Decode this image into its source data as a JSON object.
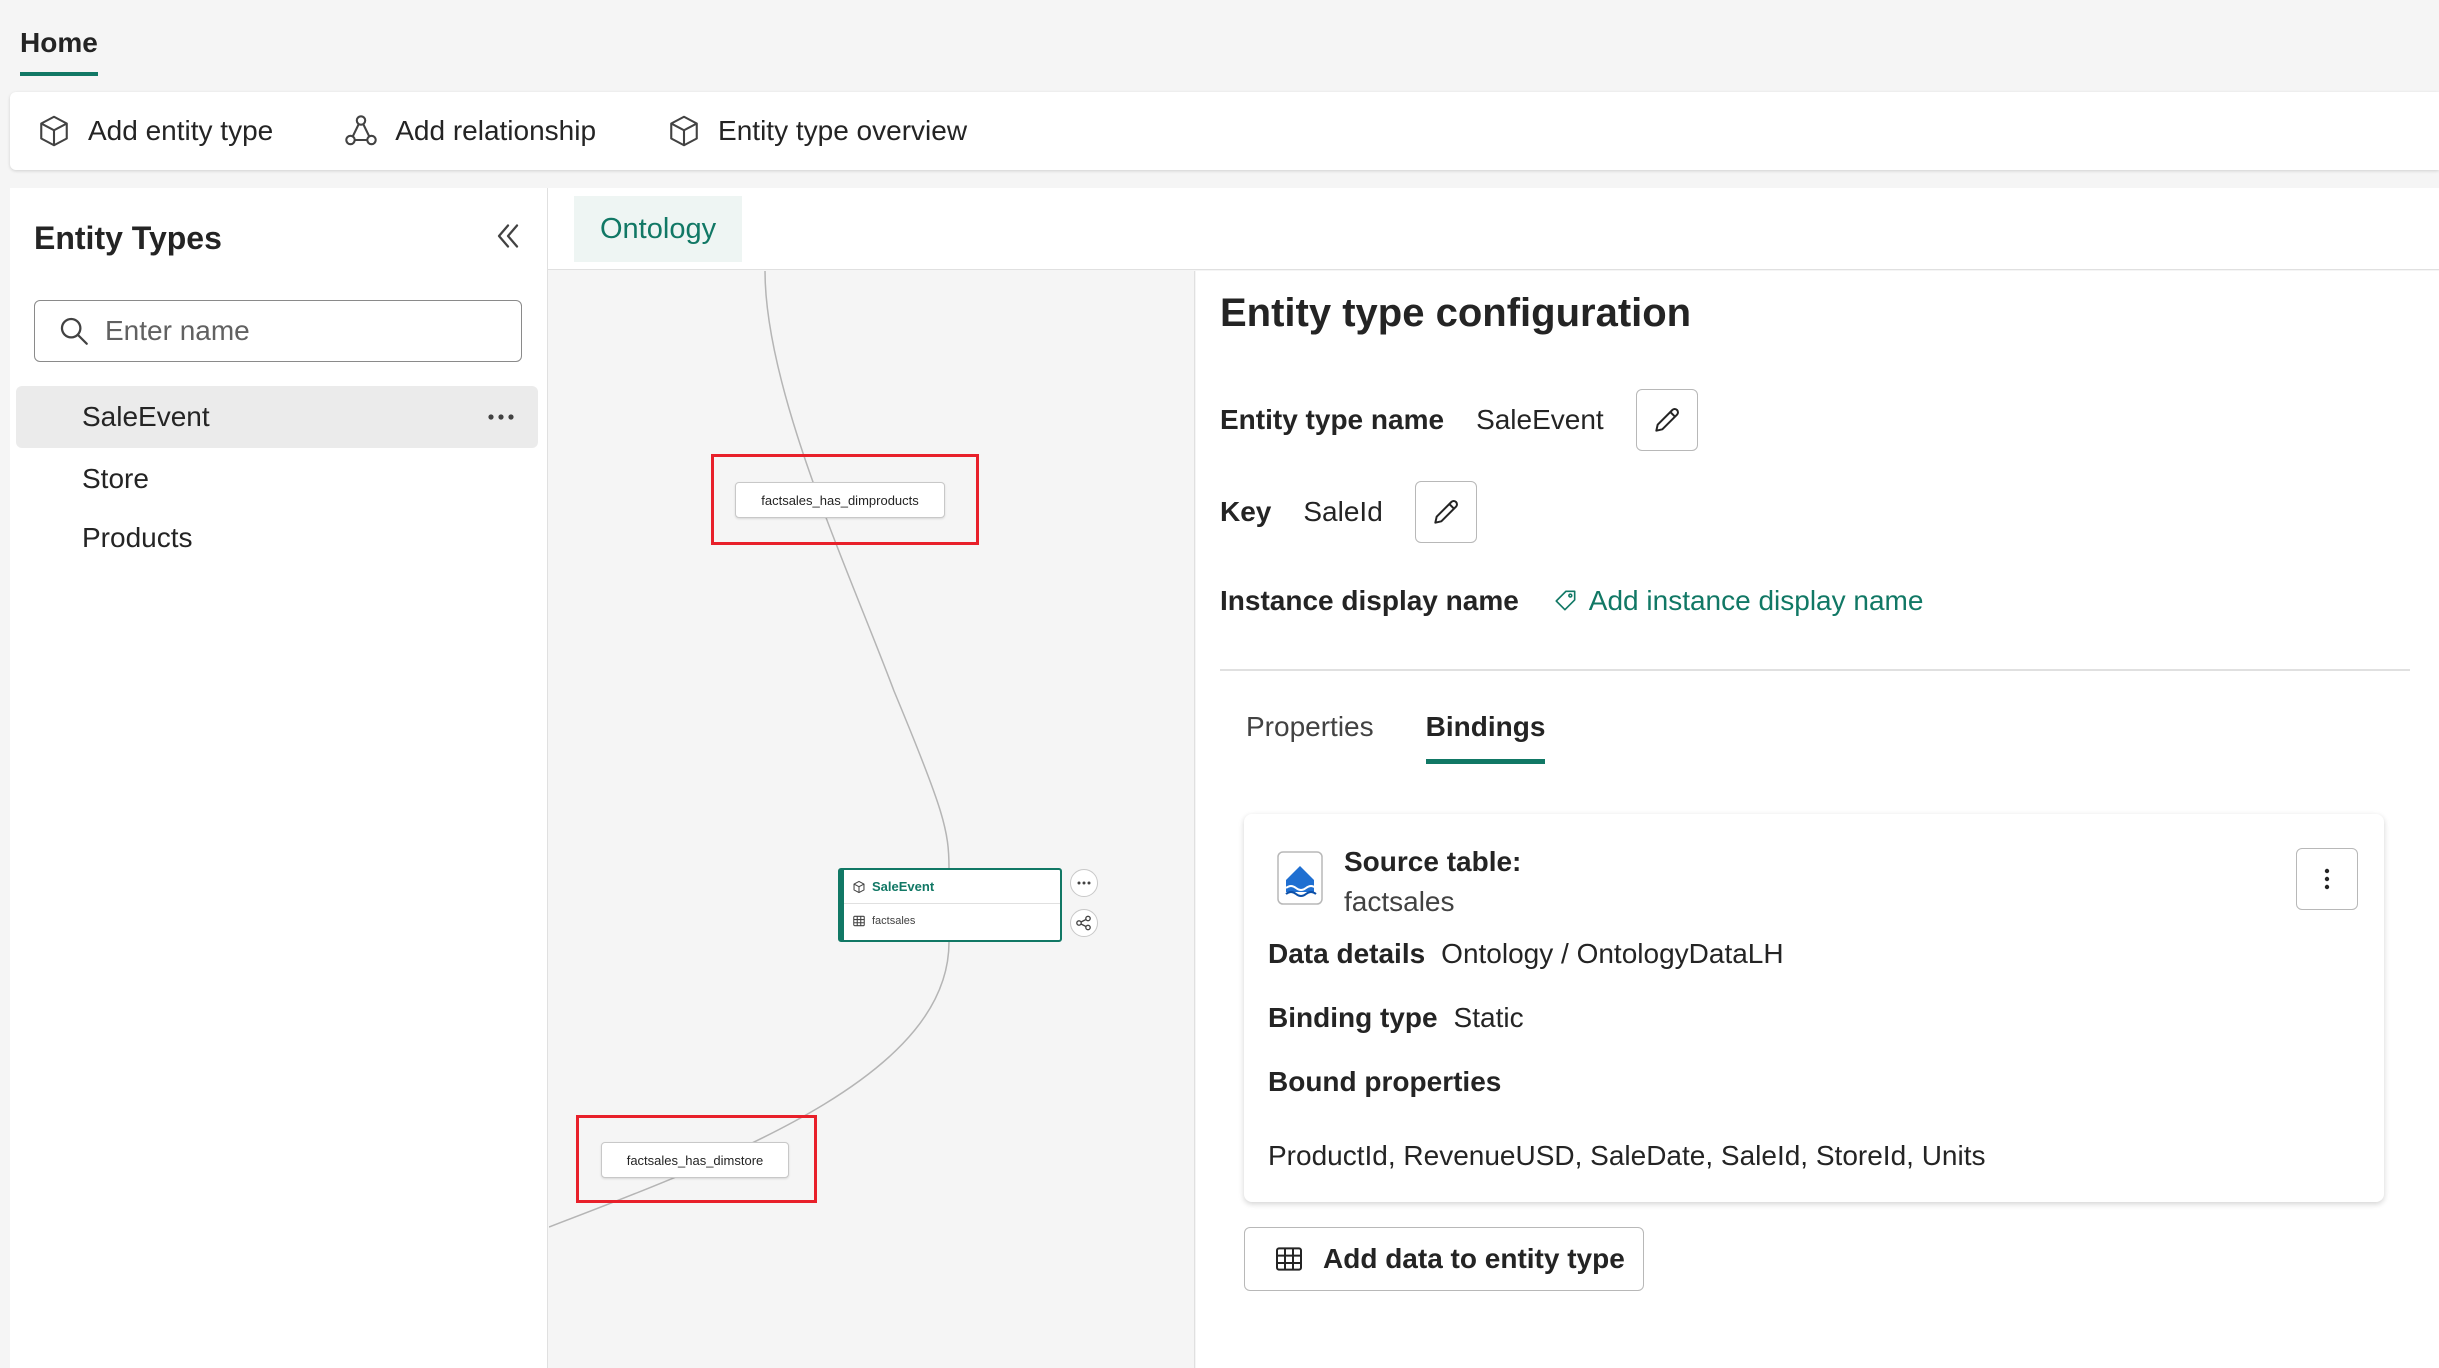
{
  "top_tab": {
    "label": "Home"
  },
  "toolbar": {
    "add_entity_type": "Add entity type",
    "add_relationship": "Add relationship",
    "entity_type_overview": "Entity type overview"
  },
  "left_panel": {
    "title": "Entity Types",
    "search_placeholder": "Enter name",
    "items": [
      {
        "label": "SaleEvent",
        "selected": true
      },
      {
        "label": "Store",
        "selected": false
      },
      {
        "label": "Products",
        "selected": false
      }
    ]
  },
  "canvas": {
    "tab_label": "Ontology",
    "relationships": [
      {
        "label": "factsales_has_dimproducts"
      },
      {
        "label": "factsales_has_dimstore"
      }
    ],
    "node": {
      "title": "SaleEvent",
      "source": "factsales"
    }
  },
  "config": {
    "title": "Entity type configuration",
    "entity_type_name_label": "Entity type name",
    "entity_type_name_value": "SaleEvent",
    "key_label": "Key",
    "key_value": "SaleId",
    "instance_display_label": "Instance display name",
    "add_instance_display": "Add instance display name",
    "tabs": [
      {
        "label": "Properties",
        "active": false
      },
      {
        "label": "Bindings",
        "active": true
      }
    ],
    "binding": {
      "source_table_label": "Source table:",
      "source_table_value": "factsales",
      "data_details_label": "Data details",
      "data_details_value": "Ontology / OntologyDataLH",
      "binding_type_label": "Binding type",
      "binding_type_value": "Static",
      "bound_properties_label": "Bound properties",
      "bound_properties_value": "ProductId, RevenueUSD, SaleDate, SaleId, StoreId, Units"
    },
    "add_data_button": "Add data to entity type"
  },
  "colors": {
    "accent": "#117865",
    "highlight_box": "#e8202a",
    "background": "#f5f5f5"
  }
}
